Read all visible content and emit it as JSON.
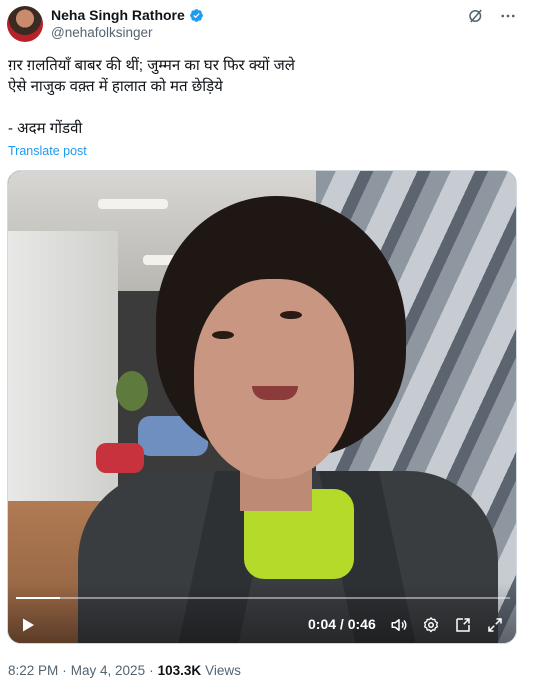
{
  "author": {
    "display_name": "Neha Singh Rathore",
    "handle": "@nehafolksinger",
    "verified": true
  },
  "header_icons": [
    "grok-icon",
    "more-icon"
  ],
  "post": {
    "text": "ग़र ग़लतियाँ बाबर की थीं; जुम्मन का घर फिर क्यों जले\nऐसे नाजुक वक़्त में हालात को मत छेड़िये\n\n- अदम गोंडवी",
    "translate_label": "Translate post"
  },
  "video": {
    "current_time": "0:04",
    "separator": "/",
    "duration": "0:46",
    "progress": 0.09,
    "controls": [
      "play-icon",
      "volume-icon",
      "settings-icon",
      "picture-in-picture-icon",
      "fullscreen-icon"
    ]
  },
  "meta": {
    "time": "8:22 PM",
    "dot": "·",
    "date": "May 4, 2025",
    "views_count": "103.3K",
    "views_label": "Views"
  },
  "colors": {
    "accent": "#1d9bf0",
    "text": "#0f1419",
    "secondary": "#536471"
  }
}
